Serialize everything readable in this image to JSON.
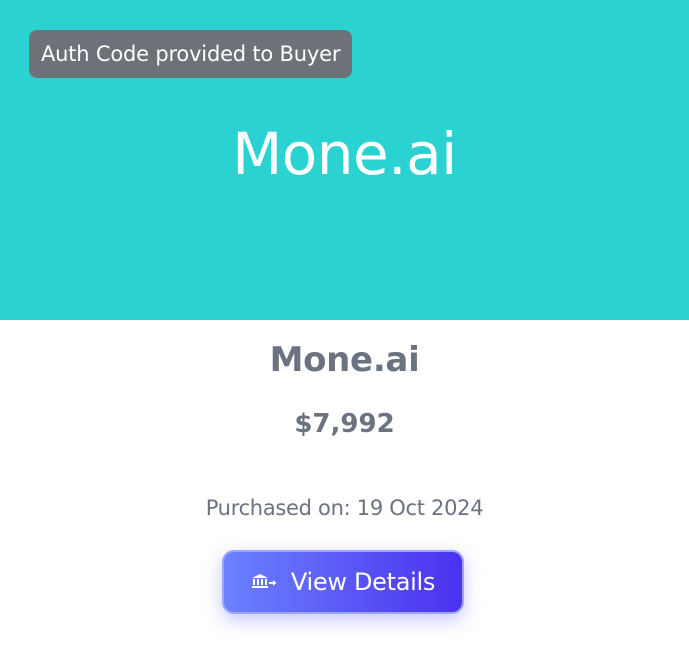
{
  "card": {
    "badge": "Auth Code provided to Buyer",
    "hero_title": "Mone.ai",
    "hero_color": "#2BD2D2",
    "name": "Mone.ai",
    "price": "$7,992",
    "purchased": "Purchased on: 19 Oct 2024",
    "button": {
      "label": "View Details",
      "icon": "bank-transfer-icon",
      "gradient_start": "#6B82FF",
      "gradient_end": "#4B31EE"
    }
  }
}
